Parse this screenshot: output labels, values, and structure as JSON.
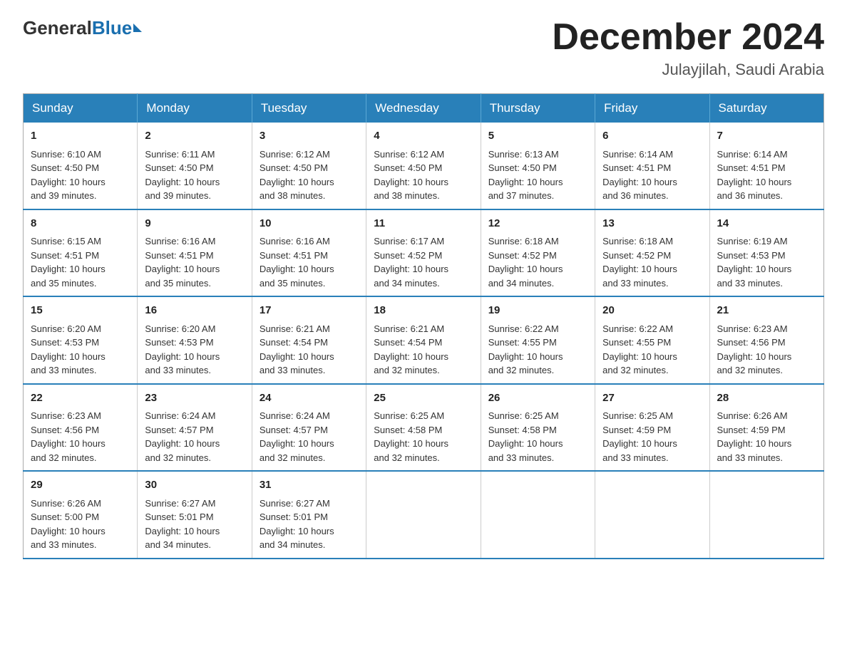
{
  "logo": {
    "general": "General",
    "blue": "Blue"
  },
  "title": "December 2024",
  "subtitle": "Julayjilah, Saudi Arabia",
  "header_days": [
    "Sunday",
    "Monday",
    "Tuesday",
    "Wednesday",
    "Thursday",
    "Friday",
    "Saturday"
  ],
  "weeks": [
    [
      {
        "day": "1",
        "sunrise": "6:10 AM",
        "sunset": "4:50 PM",
        "daylight": "10 hours and 39 minutes."
      },
      {
        "day": "2",
        "sunrise": "6:11 AM",
        "sunset": "4:50 PM",
        "daylight": "10 hours and 39 minutes."
      },
      {
        "day": "3",
        "sunrise": "6:12 AM",
        "sunset": "4:50 PM",
        "daylight": "10 hours and 38 minutes."
      },
      {
        "day": "4",
        "sunrise": "6:12 AM",
        "sunset": "4:50 PM",
        "daylight": "10 hours and 38 minutes."
      },
      {
        "day": "5",
        "sunrise": "6:13 AM",
        "sunset": "4:50 PM",
        "daylight": "10 hours and 37 minutes."
      },
      {
        "day": "6",
        "sunrise": "6:14 AM",
        "sunset": "4:51 PM",
        "daylight": "10 hours and 36 minutes."
      },
      {
        "day": "7",
        "sunrise": "6:14 AM",
        "sunset": "4:51 PM",
        "daylight": "10 hours and 36 minutes."
      }
    ],
    [
      {
        "day": "8",
        "sunrise": "6:15 AM",
        "sunset": "4:51 PM",
        "daylight": "10 hours and 35 minutes."
      },
      {
        "day": "9",
        "sunrise": "6:16 AM",
        "sunset": "4:51 PM",
        "daylight": "10 hours and 35 minutes."
      },
      {
        "day": "10",
        "sunrise": "6:16 AM",
        "sunset": "4:51 PM",
        "daylight": "10 hours and 35 minutes."
      },
      {
        "day": "11",
        "sunrise": "6:17 AM",
        "sunset": "4:52 PM",
        "daylight": "10 hours and 34 minutes."
      },
      {
        "day": "12",
        "sunrise": "6:18 AM",
        "sunset": "4:52 PM",
        "daylight": "10 hours and 34 minutes."
      },
      {
        "day": "13",
        "sunrise": "6:18 AM",
        "sunset": "4:52 PM",
        "daylight": "10 hours and 33 minutes."
      },
      {
        "day": "14",
        "sunrise": "6:19 AM",
        "sunset": "4:53 PM",
        "daylight": "10 hours and 33 minutes."
      }
    ],
    [
      {
        "day": "15",
        "sunrise": "6:20 AM",
        "sunset": "4:53 PM",
        "daylight": "10 hours and 33 minutes."
      },
      {
        "day": "16",
        "sunrise": "6:20 AM",
        "sunset": "4:53 PM",
        "daylight": "10 hours and 33 minutes."
      },
      {
        "day": "17",
        "sunrise": "6:21 AM",
        "sunset": "4:54 PM",
        "daylight": "10 hours and 33 minutes."
      },
      {
        "day": "18",
        "sunrise": "6:21 AM",
        "sunset": "4:54 PM",
        "daylight": "10 hours and 32 minutes."
      },
      {
        "day": "19",
        "sunrise": "6:22 AM",
        "sunset": "4:55 PM",
        "daylight": "10 hours and 32 minutes."
      },
      {
        "day": "20",
        "sunrise": "6:22 AM",
        "sunset": "4:55 PM",
        "daylight": "10 hours and 32 minutes."
      },
      {
        "day": "21",
        "sunrise": "6:23 AM",
        "sunset": "4:56 PM",
        "daylight": "10 hours and 32 minutes."
      }
    ],
    [
      {
        "day": "22",
        "sunrise": "6:23 AM",
        "sunset": "4:56 PM",
        "daylight": "10 hours and 32 minutes."
      },
      {
        "day": "23",
        "sunrise": "6:24 AM",
        "sunset": "4:57 PM",
        "daylight": "10 hours and 32 minutes."
      },
      {
        "day": "24",
        "sunrise": "6:24 AM",
        "sunset": "4:57 PM",
        "daylight": "10 hours and 32 minutes."
      },
      {
        "day": "25",
        "sunrise": "6:25 AM",
        "sunset": "4:58 PM",
        "daylight": "10 hours and 32 minutes."
      },
      {
        "day": "26",
        "sunrise": "6:25 AM",
        "sunset": "4:58 PM",
        "daylight": "10 hours and 33 minutes."
      },
      {
        "day": "27",
        "sunrise": "6:25 AM",
        "sunset": "4:59 PM",
        "daylight": "10 hours and 33 minutes."
      },
      {
        "day": "28",
        "sunrise": "6:26 AM",
        "sunset": "4:59 PM",
        "daylight": "10 hours and 33 minutes."
      }
    ],
    [
      {
        "day": "29",
        "sunrise": "6:26 AM",
        "sunset": "5:00 PM",
        "daylight": "10 hours and 33 minutes."
      },
      {
        "day": "30",
        "sunrise": "6:27 AM",
        "sunset": "5:01 PM",
        "daylight": "10 hours and 34 minutes."
      },
      {
        "day": "31",
        "sunrise": "6:27 AM",
        "sunset": "5:01 PM",
        "daylight": "10 hours and 34 minutes."
      },
      null,
      null,
      null,
      null
    ]
  ],
  "labels": {
    "sunrise": "Sunrise:",
    "sunset": "Sunset:",
    "daylight": "Daylight:"
  }
}
